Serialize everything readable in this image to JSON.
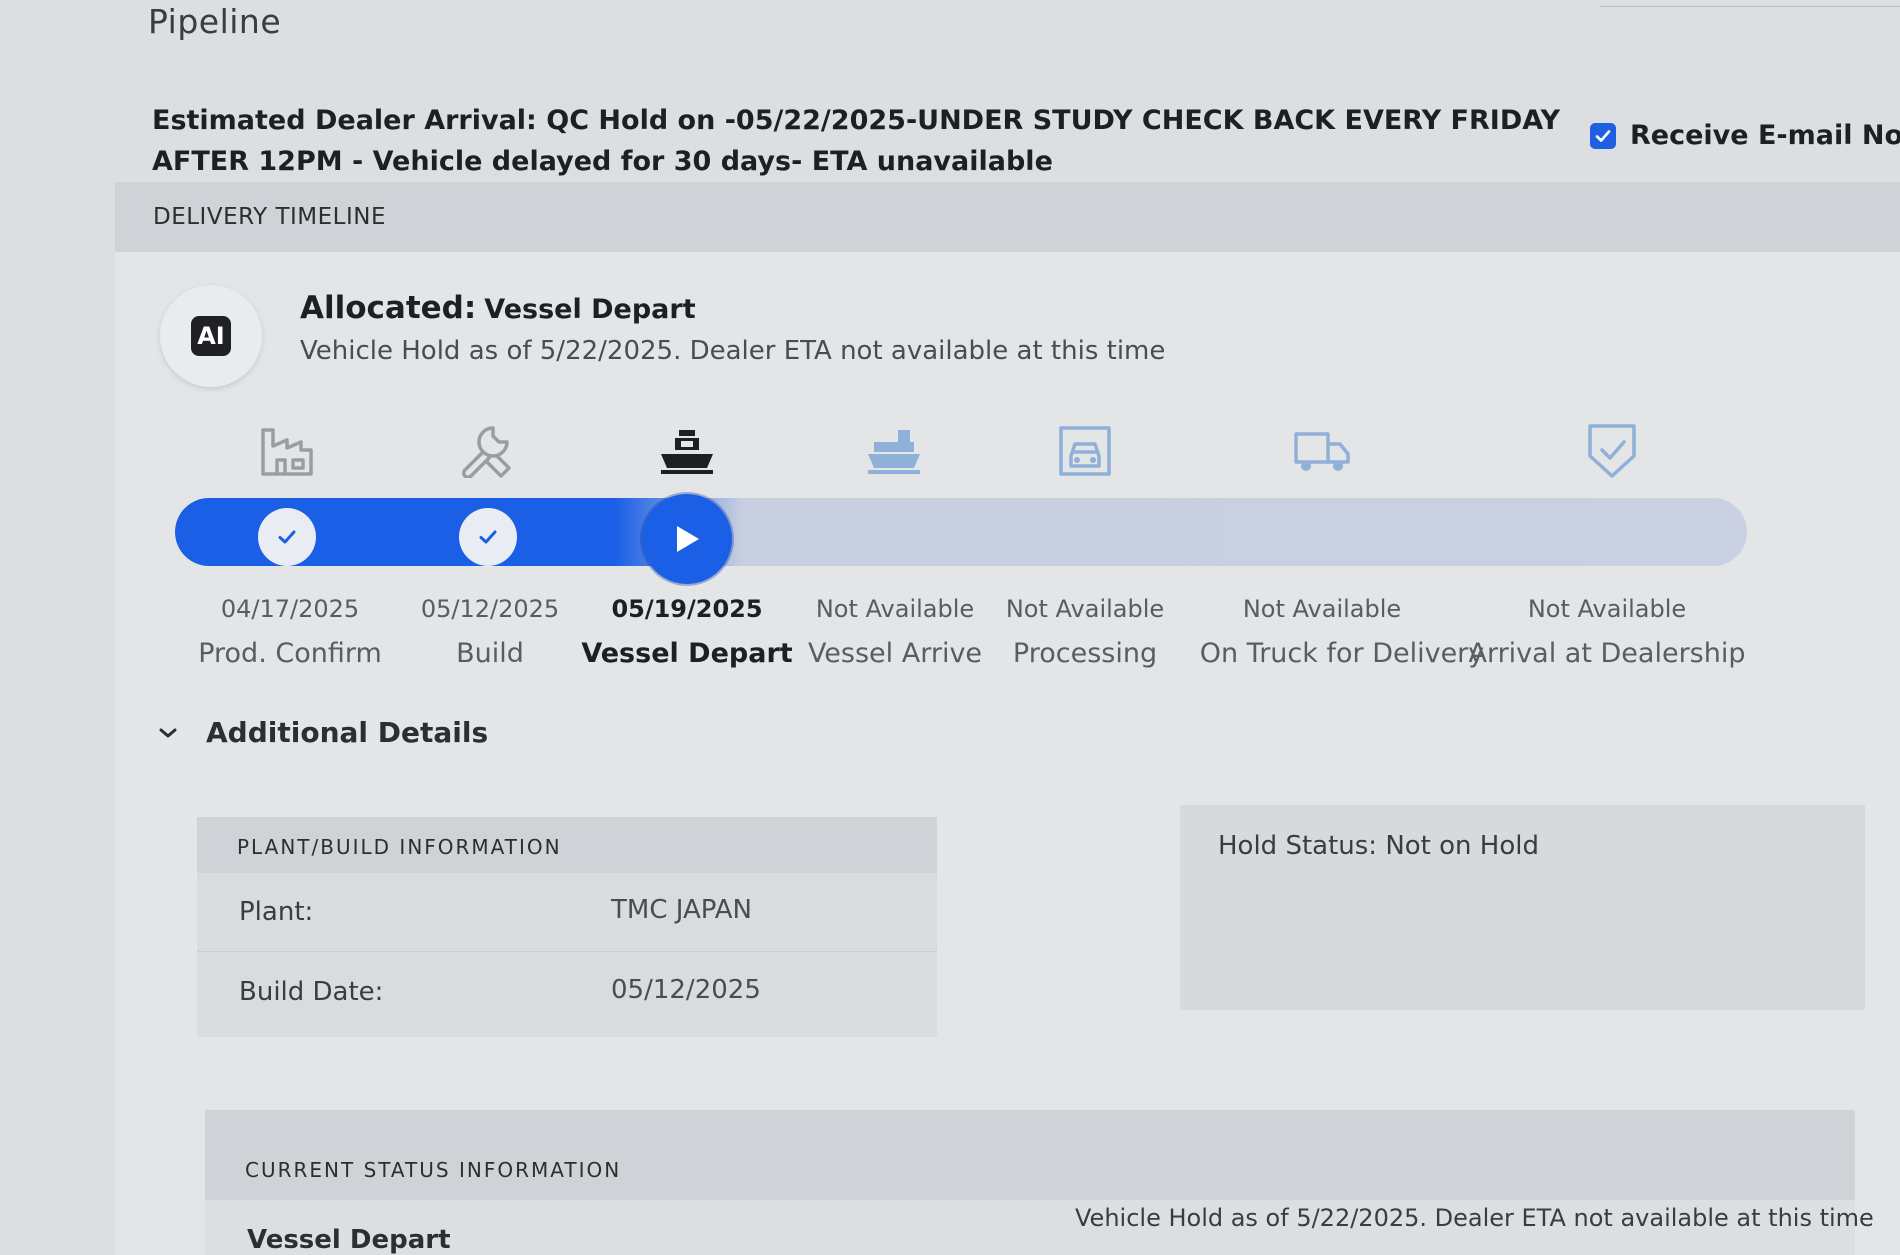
{
  "page": {
    "title": "Pipeline"
  },
  "eta": {
    "text": "Estimated Dealer Arrival: QC Hold on -05/22/2025-UNDER STUDY CHECK BACK EVERY FRIDAY AFTER 12PM - Vehicle delayed for 30 days- ETA unavailable",
    "notify_label": "Receive E-mail Notifica",
    "notify_checked": true
  },
  "timeline": {
    "section_title": "DELIVERY TIMELINE",
    "ai_badge": "AI",
    "status_label": "Allocated:",
    "status_value": "Vessel Depart",
    "status_description": "Vehicle Hold as of 5/22/2025. Dealer ETA not available at this time",
    "colors": {
      "active": "#1b5fe6",
      "inactive": "#c9d1e2"
    },
    "stages": [
      {
        "name": "Prod. Confirm",
        "date": "04/17/2025",
        "state": "done",
        "icon": "factory-icon"
      },
      {
        "name": "Build",
        "date": "05/12/2025",
        "state": "done",
        "icon": "wrench-icon"
      },
      {
        "name": "Vessel Depart",
        "date": "05/19/2025",
        "state": "current",
        "icon": "ship-icon"
      },
      {
        "name": "Vessel Arrive",
        "date": "Not Available",
        "state": "pending",
        "icon": "ship-arrive-icon"
      },
      {
        "name": "Processing",
        "date": "Not Available",
        "state": "pending",
        "icon": "processing-icon"
      },
      {
        "name": "On Truck for Delivery",
        "date": "Not Available",
        "state": "pending",
        "icon": "truck-icon"
      },
      {
        "name": "Arrival at Dealership",
        "date": "Not Available",
        "state": "pending",
        "icon": "shield-check-icon"
      }
    ]
  },
  "details": {
    "toggle_label": "Additional Details",
    "plant": {
      "header": "PLANT/BUILD INFORMATION",
      "rows": [
        {
          "label": "Plant:",
          "value": "TMC JAPAN"
        },
        {
          "label": "Build Date:",
          "value": "05/12/2025"
        }
      ]
    },
    "hold_status": "Hold Status: Not on Hold",
    "current": {
      "header": "CURRENT STATUS INFORMATION",
      "label": "Vessel Depart",
      "value": "Vehicle Hold as of 5/22/2025. Dealer ETA not available at this time"
    }
  }
}
